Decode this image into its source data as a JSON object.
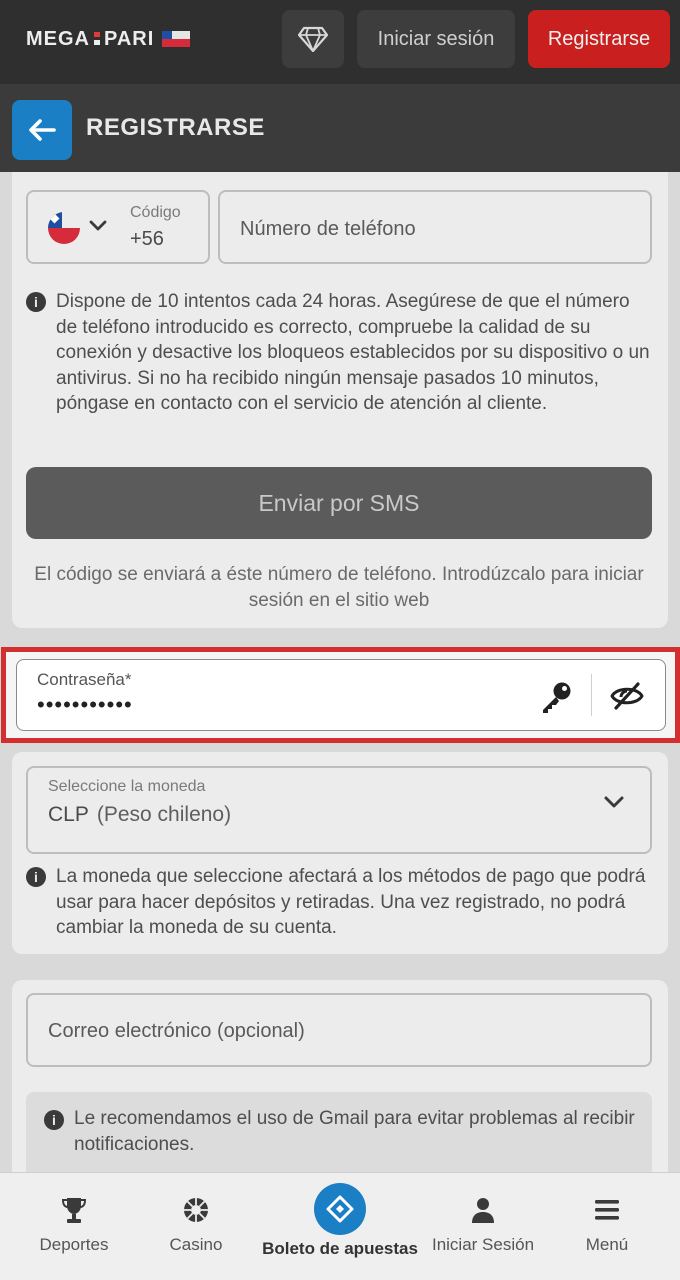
{
  "topbar": {
    "logo_left": "MEGA",
    "logo_right": "PARI",
    "login_label": "Iniciar sesión",
    "register_label": "Registrarse"
  },
  "header": {
    "title": "REGISTRARSE"
  },
  "phone": {
    "code_label": "Código",
    "code_value": "+56",
    "phone_placeholder": "Número de teléfono",
    "info_text": "Dispone de 10 intentos cada 24 horas. Asegúrese de que el número de teléfono introducido es correcto, compruebe la calidad de su conexión y desactive los bloqueos establecidos por su dispositivo o un antivirus. Si no ha recibido ningún mensaje pasados 10 minutos, póngase en contacto con el servicio de atención al cliente.",
    "sms_button_label": "Enviar por SMS",
    "sms_note": "El código se enviará a éste número de teléfono. Introdúzcalo para iniciar sesión en el sitio web"
  },
  "password": {
    "label": "Contraseña*",
    "value": "•••••••••••"
  },
  "currency": {
    "label": "Seleccione la moneda",
    "code": "CLP",
    "name": "(Peso chileno)",
    "info_text": "La moneda que seleccione afectará a los métodos de pago que podrá usar para hacer depósitos y retiradas. Una vez registrado, no podrá cambiar la moneda de su cuenta."
  },
  "email": {
    "placeholder": "Correo electrónico (opcional)",
    "tip_text": "Le recomendamos el uso de Gmail para evitar problemas al recibir notificaciones."
  },
  "bottom_nav": {
    "items": [
      {
        "label": "Deportes",
        "icon": "trophy-icon"
      },
      {
        "label": "Casino",
        "icon": "roulette-icon"
      },
      {
        "label": "Boleto de apuestas",
        "icon": "bet-slip-icon"
      },
      {
        "label": "Iniciar Sesión",
        "icon": "user-icon"
      },
      {
        "label": "Menú",
        "icon": "menu-icon"
      }
    ]
  },
  "colors": {
    "accent_blue": "#1a7fc4",
    "register_red": "#c9201f",
    "highlight_red": "#d32f2f"
  }
}
